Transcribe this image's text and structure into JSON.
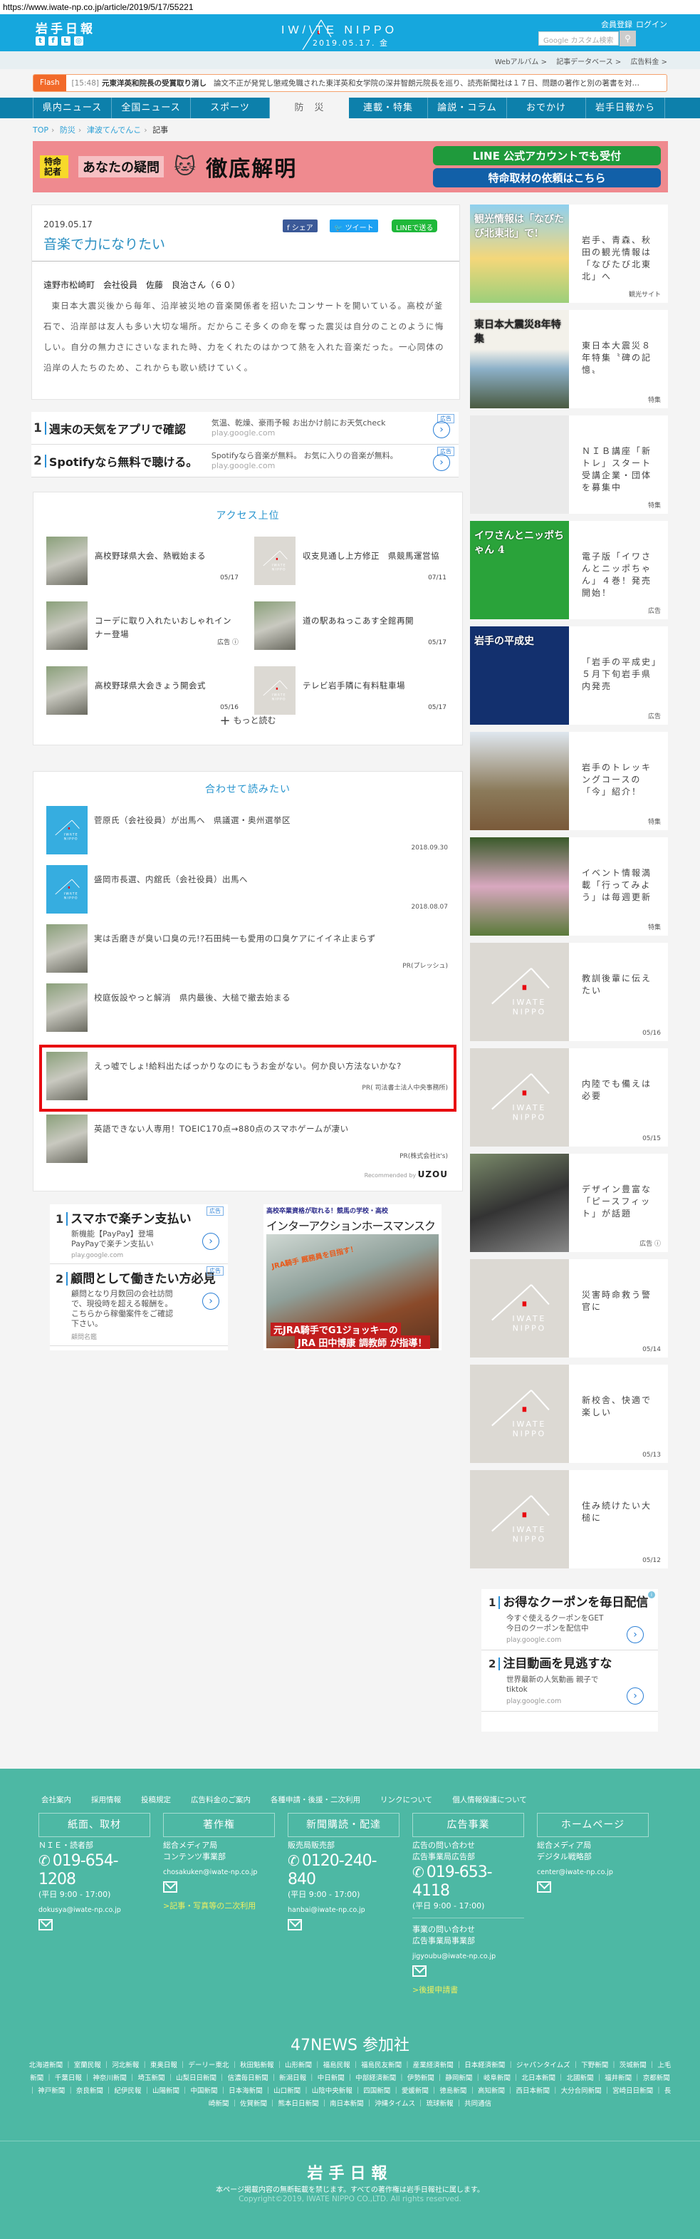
{
  "url": "https://www.iwate-np.co.jp/article/2019/5/17/55221",
  "header": {
    "logo_jp": "岩手日報",
    "brand": "IW/\\TE NIPPO",
    "date": "2019.05.17. 金",
    "register": "会員登録",
    "login": "ログイン",
    "search_placeholder": "Google カスタム検索",
    "social": [
      "twitter-icon",
      "facebook-icon",
      "line-icon",
      "instagram-icon"
    ]
  },
  "subbar": [
    "Webアルバム >",
    "記事データベース >",
    "広告料金 >"
  ],
  "flash": {
    "label": "Flash",
    "time": "[15:48]",
    "headline": "元東洋英和院長の受賞取り消し",
    "body": "論文不正が発覚し懲戒免職された東洋英和女学院の深井智朗元院長を巡り、読売新聞社は１７日、問題の著作と別の著書を対…"
  },
  "nav": [
    {
      "label": "県内ニュース"
    },
    {
      "label": "全国ニュース"
    },
    {
      "label": "スポーツ"
    },
    {
      "label": "防　災",
      "active": true
    },
    {
      "label": "連載・特集"
    },
    {
      "label": "論説・コラム"
    },
    {
      "label": "おでかけ"
    },
    {
      "label": "岩手日報から"
    }
  ],
  "breadcrumb": [
    "TOP",
    "防災",
    "津波てんでんこ",
    "記事"
  ],
  "banner": {
    "tag": "特命記者",
    "text1": "あなたの疑問",
    "text2": "徹底解明",
    "btn1": "LINE 公式アカウントでも受付",
    "btn2": "特命取材の依頼はこちら"
  },
  "article": {
    "date": "2019.05.17",
    "title": "音楽で力になりたい",
    "share": "シェア",
    "tweet": "ツイート",
    "line": "LINEで送る",
    "byline": "遠野市松崎町　会社役員　佐藤　良治さん（６０）",
    "body": "東日本大震災後から毎年、沿岸被災地の音楽関係者を招いたコンサートを開いている。高校が釜石で、沿岸部は友人も多い大切な場所。だからこそ多くの命を奪った震災は自分のことのように悔しい。自分の無力さにさいなまれた時、力をくれたのはかつて熱を入れた音楽だった。一心同体の沿岸の人たちのため、これからも歌い続けていく。"
  },
  "ads_top": [
    {
      "num": "1",
      "head": "週末の天気をアプリで確認",
      "desc": "気温、乾燥、豪雨予報 お出かけ前にお天気check",
      "domain": "play.google.com",
      "tag": "広告"
    },
    {
      "num": "2",
      "head": "Spotifyなら無料で聴ける。",
      "desc": "Spotifyなら音楽が無料。 お気に入りの音楽が無料。",
      "domain": "play.google.com",
      "tag": "広告"
    }
  ],
  "access": {
    "title": "アクセス上位",
    "more": "もっと読む",
    "items": [
      {
        "title": "高校野球県大会、熱戦始まる",
        "date": "05/17",
        "thumb": "photo"
      },
      {
        "title": "収支見通し上方修正　県競馬運営協",
        "date": "07/11",
        "thumb": "placeholder"
      },
      {
        "title": "コーデに取り入れたいおしゃれインナー登場",
        "date": "広告 ⓘ",
        "thumb": "photo"
      },
      {
        "title": "道の駅あねっこあす全館再開",
        "date": "05/17",
        "thumb": "photo"
      },
      {
        "title": "高校野球県大会きょう開会式",
        "date": "05/16",
        "thumb": "photo"
      },
      {
        "title": "テレビ岩手隣に有料駐車場",
        "date": "05/17",
        "thumb": "placeholder"
      }
    ]
  },
  "related": {
    "title": "合わせて読みたい",
    "recommended": "Recommended by",
    "uzou": "UZOU",
    "items": [
      {
        "title": "菅原氏（会社役員）が出馬へ　県議選・奥州選挙区",
        "meta": "2018.09.30",
        "thumb": "blue"
      },
      {
        "title": "盛岡市長選、内舘氏（会社役員）出馬へ",
        "meta": "2018.08.07",
        "thumb": "blue"
      },
      {
        "title": "実は舌磨きが臭い口臭の元!?石田純一も愛用の口臭ケアにイイネ止まらず",
        "meta": "PR(プレッシュ)",
        "thumb": "photo"
      },
      {
        "title": "校庭仮設やっと解消　県内最後、大槌で撤去始まる",
        "meta": "",
        "thumb": "photo"
      },
      {
        "title": "えっ嘘でしょ!給料出たばっかりなのにもうお金がない。何か良い方法ないかな?",
        "meta": "PR( 司法書士法人中央事務所)",
        "thumb": "photo",
        "highlight": true
      },
      {
        "title": "英語できない人専用！TOEIC170点→880点のスマホゲームが凄い",
        "meta": "PR(株式会社it's)",
        "thumb": "photo"
      }
    ]
  },
  "ads_bottom": [
    {
      "num": "1",
      "head": "スマホで楽チン支払い",
      "desc": "新機能【PayPay】登場 PayPayで楽チン支払い",
      "domain": "play.google.com",
      "tag": "広告"
    },
    {
      "num": "2",
      "head": "顧問として働きたい方必見",
      "desc": "顧問となり月数回の会社訪問で、現役時を超える報酬を。こちらから稼働案件をご確認下さい。",
      "domain": "顧問名鑑",
      "tag": "広告"
    }
  ],
  "horse_ad": {
    "top": "高校卒業資格が取れる！競馬の学校・高校",
    "name": "インターアクションホースマンスクール",
    "tag": "JRA騎手 厩務員を目指す！",
    "cap1": "元JRA騎手でG1ジョッキーの",
    "cap2": "JRA 田中博康 調教師 が指導！"
  },
  "sidebar": [
    {
      "title": "岩手、青森、秋田の観光情報は「なびたび北東北」へ",
      "cat": "観光サイト",
      "img": "navitabi"
    },
    {
      "title": "東日本大震災８年特集〝碑の記憶〟",
      "cat": "特集",
      "img": "shinsai"
    },
    {
      "title": "ＮＩＢ講座「新トレ」スタート　受講企業・団体を募集中",
      "cat": "特集",
      "img": "nib"
    },
    {
      "title": "電子版「イワさんとニッポちゃん」４巻！発売開始！",
      "cat": "広告",
      "img": "manga"
    },
    {
      "title": "「岩手の平成史」５月下旬岩手県内発売",
      "cat": "広告",
      "img": "heisei"
    },
    {
      "title": "岩手のトレッキングコースの「今」紹介！",
      "cat": "特集",
      "img": "forest"
    },
    {
      "title": "イベント情報満載「行ってみよう」は毎週更新",
      "cat": "特集",
      "img": "flowers"
    },
    {
      "title": "教訓後輩に伝えたい",
      "cat": "05/16",
      "img": "placeholder"
    },
    {
      "title": "内陸でも備えは必要",
      "cat": "05/15",
      "img": "placeholder"
    },
    {
      "title": "デザイン豊富な「ピースフィット」が話題",
      "cat": "広告 ⓘ",
      "img": "bench"
    },
    {
      "title": "災害時命救う警官に",
      "cat": "05/14",
      "img": "placeholder"
    },
    {
      "title": "新校舎、快適で楽しい",
      "cat": "05/13",
      "img": "placeholder"
    },
    {
      "title": "住み続けたい大槌に",
      "cat": "05/12",
      "img": "placeholder"
    }
  ],
  "sidebar_banners": {
    "navitabi": "観光情報は「なびたび北東北」で!",
    "shinsai": "東日本大震災8年特集",
    "manga": "イワさんとニッポちゃん 4",
    "heisei": "岩手の平成史"
  },
  "ads_side": [
    {
      "num": "1",
      "head": "お得なクーポンを毎日配信",
      "desc": "今すぐ使えるクーポンをGET 今日のクーポンを配信中",
      "domain": "play.google.com"
    },
    {
      "num": "2",
      "head": "注目動画を見逃すな",
      "desc": "世界最新の人気動画 親子でtiktok",
      "domain": "play.google.com"
    }
  ],
  "footer": {
    "links": [
      "会社案内",
      "採用情報",
      "投稿規定",
      "広告料金のご案内",
      "各種申請・後援・二次利用",
      "リンクについて",
      "個人情報保護について"
    ],
    "cols": [
      {
        "title": "紙面、取材",
        "lines": [
          "ＮＩＥ・読者部"
        ],
        "phone": "019-654-1208",
        "hours": "(平日 9:00 - 17:00)",
        "email": "dokusya@iwate-np.co.jp"
      },
      {
        "title": "著作権",
        "lines": [
          "総合メディア局",
          "コンテンツ事業部"
        ],
        "email": "chosakuken@iwate-np.co.jp",
        "link": ">記事・写真等の二次利用"
      },
      {
        "title": "新聞購読・配達",
        "lines": [
          "販売局販売部"
        ],
        "phone": "0120-240-840",
        "hours": "(平日 9:00 - 17:00)",
        "email": "hanbai@iwate-np.co.jp"
      },
      {
        "title": "広告事業",
        "lines": [
          "広告の問い合わせ",
          "広告事業局広告部"
        ],
        "phone": "019-653-4118",
        "hours": "(平日 9:00 - 17:00)",
        "lines2": [
          "事業の問い合わせ",
          "広告事業局事業部"
        ],
        "email2": "jigyoubu@iwate-np.co.jp",
        "link": ">後援申請書"
      },
      {
        "title": "ホームページ",
        "lines": [
          "総合メディア局",
          "デジタル戦略部"
        ],
        "email": "center@iwate-np.co.jp"
      }
    ],
    "news47_title": "47NEWS 参加社",
    "papers": [
      "北海道新聞",
      "室蘭民報",
      "河北新報",
      "東奥日報",
      "デーリー東北",
      "秋田魁新報",
      "山形新聞",
      "福島民報",
      "福島民友新聞",
      "産業経済新聞",
      "日本経済新聞",
      "ジャパンタイムズ",
      "下野新聞",
      "茨城新聞",
      "上毛新聞",
      "千葉日報",
      "神奈川新聞",
      "埼玉新聞",
      "山梨日日新聞",
      "信濃毎日新聞",
      "新潟日報",
      "中日新聞",
      "中部経済新聞",
      "伊勢新聞",
      "静岡新聞",
      "岐阜新聞",
      "北日本新聞",
      "北國新聞",
      "福井新聞",
      "京都新聞",
      "神戸新聞",
      "奈良新聞",
      "紀伊民報",
      "山陽新聞",
      "中国新聞",
      "日本海新聞",
      "山口新聞",
      "山陰中央新報",
      "四国新聞",
      "愛媛新聞",
      "徳島新聞",
      "高知新聞",
      "西日本新聞",
      "大分合同新聞",
      "宮崎日日新聞",
      "長崎新聞",
      "佐賀新聞",
      "熊本日日新聞",
      "南日本新聞",
      "沖縄タイムス",
      "琉球新報",
      "共同通信"
    ],
    "logo": "岩手日報",
    "notice": "本ページ掲載内容の無断転載を禁じます。すべての著作権は岩手日報社に属します。",
    "copyright": "Copyright©2019, IWATE NIPPO CO.,LTD. All rights reserved."
  },
  "colors": {
    "header": "#16a7dd",
    "nav": "#0d80ab",
    "flash": "#f26a2a",
    "title": "#2a8fc2",
    "footer": "#4db8a4",
    "highlight": "#e8060f"
  }
}
